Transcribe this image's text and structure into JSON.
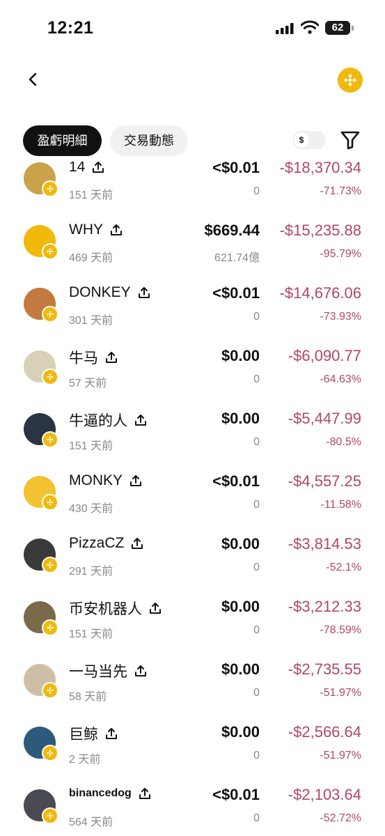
{
  "status_bar": {
    "time": "12:21",
    "battery": "62"
  },
  "tabs": {
    "active": "盈虧明細",
    "inactive": "交易動態"
  },
  "currency_toggle": {
    "symbol": "$"
  },
  "colors": {
    "negative": "#b2456b",
    "bnb": "#f0b90b"
  },
  "rows": [
    {
      "name": "14",
      "age": "151 天前",
      "price": "<$0.01",
      "sub": "0",
      "pnl": "-$18,370.34",
      "pct": "-71.73%",
      "avatar_color": "#c9a24a"
    },
    {
      "name": "WHY",
      "age": "469 天前",
      "price": "$669.44",
      "sub": "621.74億",
      "pnl": "-$15,235.88",
      "pct": "-95.79%",
      "avatar_color": "#f0b90b"
    },
    {
      "name": "DONKEY",
      "age": "301 天前",
      "price": "<$0.01",
      "sub": "0",
      "pnl": "-$14,676.06",
      "pct": "-73.93%",
      "avatar_color": "#c37a3e"
    },
    {
      "name": "牛马",
      "age": "57 天前",
      "price": "$0.00",
      "sub": "0",
      "pnl": "-$6,090.77",
      "pct": "-64.63%",
      "avatar_color": "#d8d1b8"
    },
    {
      "name": "牛逼的人",
      "age": "151 天前",
      "price": "$0.00",
      "sub": "0",
      "pnl": "-$5,447.99",
      "pct": "-80.5%",
      "avatar_color": "#2a3442"
    },
    {
      "name": "MONKY",
      "age": "430 天前",
      "price": "<$0.01",
      "sub": "0",
      "pnl": "-$4,557.25",
      "pct": "-11.58%",
      "avatar_color": "#f2c230"
    },
    {
      "name": "PizzaCZ",
      "age": "291 天前",
      "price": "$0.00",
      "sub": "0",
      "pnl": "-$3,814.53",
      "pct": "-52.1%",
      "avatar_color": "#3a3a3a"
    },
    {
      "name": "币安机器人",
      "age": "151 天前",
      "price": "$0.00",
      "sub": "0",
      "pnl": "-$3,212.33",
      "pct": "-78.59%",
      "avatar_color": "#7a6a4a"
    },
    {
      "name": "一马当先",
      "age": "58 天前",
      "price": "$0.00",
      "sub": "0",
      "pnl": "-$2,735.55",
      "pct": "-51.97%",
      "avatar_color": "#cdbfa5"
    },
    {
      "name": "巨鲸",
      "age": "2 天前",
      "price": "$0.00",
      "sub": "0",
      "pnl": "-$2,566.64",
      "pct": "-51.97%",
      "avatar_color": "#2d5a7a"
    },
    {
      "name": "binancedog",
      "age": "564 天前",
      "price": "<$0.01",
      "sub": "0",
      "pnl": "-$2,103.64",
      "pct": "-52.72%",
      "avatar_color": "#4a4a52",
      "small_name": true
    }
  ]
}
